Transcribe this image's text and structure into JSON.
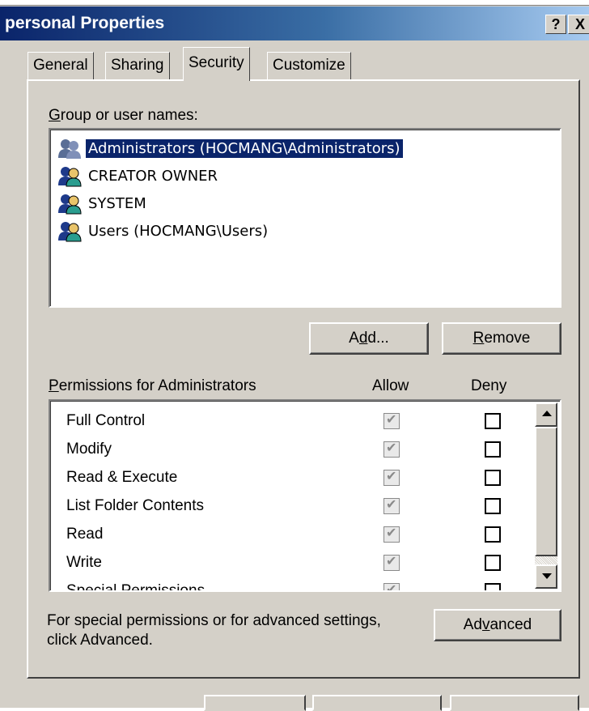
{
  "window": {
    "title": "personal Properties",
    "help_label": "?",
    "close_label": "X"
  },
  "tabs": [
    {
      "label": "General"
    },
    {
      "label": "Sharing"
    },
    {
      "label": "Security"
    },
    {
      "label": "Customize"
    }
  ],
  "groups": {
    "label_first": "G",
    "label_rest": "roup or user names:",
    "items": [
      {
        "label": "Administrators (HOCMANG\\Administrators)"
      },
      {
        "label": "CREATOR OWNER"
      },
      {
        "label": "SYSTEM"
      },
      {
        "label": "Users (HOCMANG\\Users)"
      }
    ],
    "add_pre": "A",
    "add_u": "d",
    "add_post": "d...",
    "remove_u": "R",
    "remove_post": "emove"
  },
  "permissions": {
    "label_u": "P",
    "label_rest": "ermissions for Administrators",
    "allow_header": "Allow",
    "deny_header": "Deny",
    "rows": [
      {
        "label": "Full Control"
      },
      {
        "label": "Modify"
      },
      {
        "label": "Read & Execute"
      },
      {
        "label": "List Folder Contents"
      },
      {
        "label": "Read"
      },
      {
        "label": "Write"
      },
      {
        "label": "Special Permissions"
      }
    ]
  },
  "advanced": {
    "note_line1": "For special permissions or for advanced settings,",
    "note_line2": "click Advanced.",
    "btn_pre": "Ad",
    "btn_u": "v",
    "btn_post": "anced"
  }
}
